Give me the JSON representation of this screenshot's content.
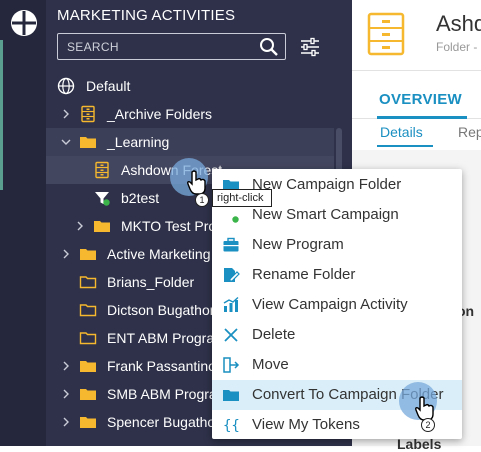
{
  "sidebar": {
    "title": "MARKETING ACTIVITIES",
    "search_placeholder": "SEARCH",
    "tree": [
      {
        "label": "Default",
        "icon": "globe-icon",
        "level": 0
      },
      {
        "label": "_Archive Folders",
        "icon": "archive-icon",
        "level": 1,
        "arrow": "collapsed"
      },
      {
        "label": "_Learning",
        "icon": "folder-icon",
        "level": 1,
        "arrow": "expanded"
      },
      {
        "label": "Ashdown Forest",
        "icon": "archive-icon",
        "level": 2
      },
      {
        "label": "b2test",
        "icon": "smart-campaign-icon",
        "level": 2
      },
      {
        "label": "MKTO Test Pro",
        "icon": "folder-icon",
        "level": 2,
        "arrow": "collapsed"
      },
      {
        "label": "Active Marketing",
        "icon": "folder-icon",
        "level": 1,
        "arrow": "collapsed"
      },
      {
        "label": "Brians_Folder",
        "icon": "folder-outline-icon",
        "level": 1
      },
      {
        "label": "Dictson Bugathon",
        "icon": "folder-outline-icon",
        "level": 1
      },
      {
        "label": "ENT ABM Progra",
        "icon": "folder-outline-icon",
        "level": 1
      },
      {
        "label": "Frank Passantino",
        "icon": "folder-icon",
        "level": 1,
        "arrow": "collapsed"
      },
      {
        "label": "SMB ABM Progra",
        "icon": "folder-icon",
        "level": 1,
        "arrow": "collapsed"
      },
      {
        "label": "Spencer Bugatho",
        "icon": "folder-icon",
        "level": 1,
        "arrow": "collapsed"
      }
    ]
  },
  "main": {
    "title": "Ashd",
    "subtitle": "Folder -",
    "tab": "OVERVIEW",
    "subtab_details": "Details",
    "subtab_rep": "Rep",
    "partial_on": "on",
    "partial_labels": "Labels"
  },
  "context_menu": {
    "items": [
      {
        "label": "New Campaign Folder",
        "icon": "folder-icon"
      },
      {
        "label": "New Smart Campaign",
        "icon": "smart-campaign-icon"
      },
      {
        "label": "New Program",
        "icon": "briefcase-icon"
      },
      {
        "label": "Rename Folder",
        "icon": "rename-icon"
      },
      {
        "label": "View Campaign Activity",
        "icon": "activity-chart-icon"
      },
      {
        "label": "Delete",
        "icon": "delete-x-icon"
      },
      {
        "label": "Move",
        "icon": "move-icon"
      },
      {
        "label": "Convert To Campaign Folder",
        "icon": "folder-icon",
        "highlighted": true
      },
      {
        "label": "View My Tokens",
        "icon": "tokens-icon"
      }
    ]
  },
  "annotations": {
    "tooltip": "right-click",
    "step1": "1",
    "step2": "2"
  },
  "colors": {
    "sidebar_bg": "#2e3149",
    "rail_bg": "#25283d",
    "accent": "#1a8fc1",
    "folder": "#f5b82e",
    "menu_icon": "#1a8fc1",
    "highlight": "#d9eef8"
  }
}
